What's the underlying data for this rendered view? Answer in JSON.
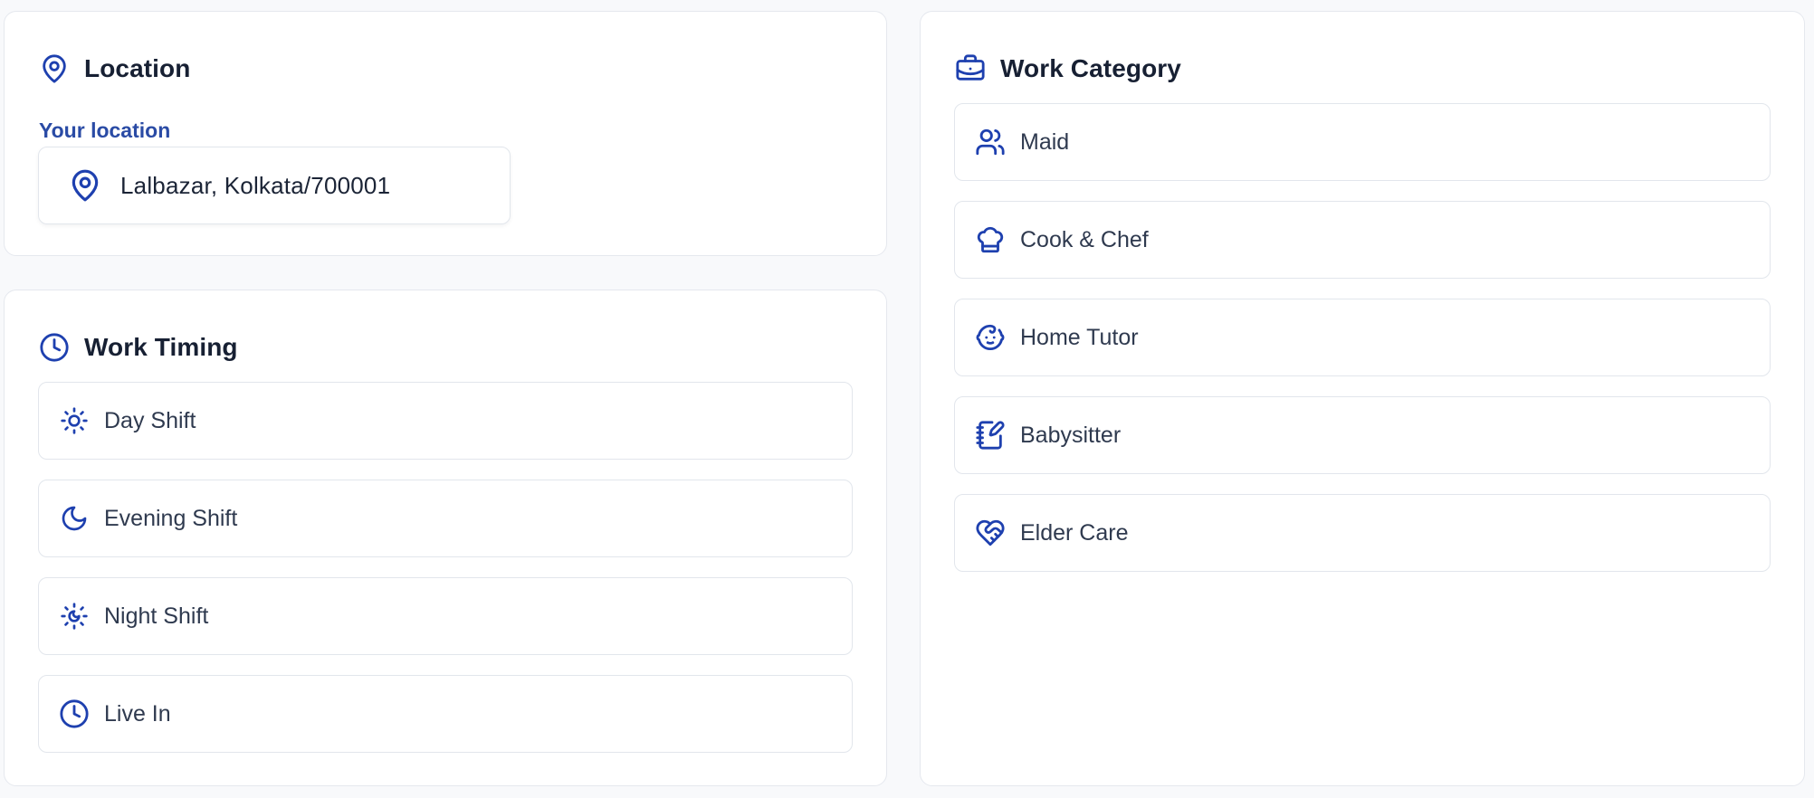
{
  "accent_color": "#1e40af",
  "location": {
    "title": "Location",
    "icon": "map-pin-icon",
    "field_label": "Your location",
    "value": "Lalbazar, Kolkata/700001"
  },
  "work_timing": {
    "title": "Work Timing",
    "icon": "clock-icon",
    "options": [
      {
        "label": "Day Shift",
        "icon": "sun-icon"
      },
      {
        "label": "Evening Shift",
        "icon": "moon-icon"
      },
      {
        "label": "Night Shift",
        "icon": "sun-moon-icon"
      },
      {
        "label": "Live In",
        "icon": "clock-icon"
      }
    ]
  },
  "work_category": {
    "title": "Work Category",
    "icon": "briefcase-icon",
    "options": [
      {
        "label": "Maid",
        "icon": "users-icon"
      },
      {
        "label": "Cook & Chef",
        "icon": "chef-hat-icon"
      },
      {
        "label": "Home Tutor",
        "icon": "baby-icon"
      },
      {
        "label": "Babysitter",
        "icon": "notebook-pen-icon"
      },
      {
        "label": "Elder Care",
        "icon": "heart-handshake-icon"
      }
    ]
  }
}
